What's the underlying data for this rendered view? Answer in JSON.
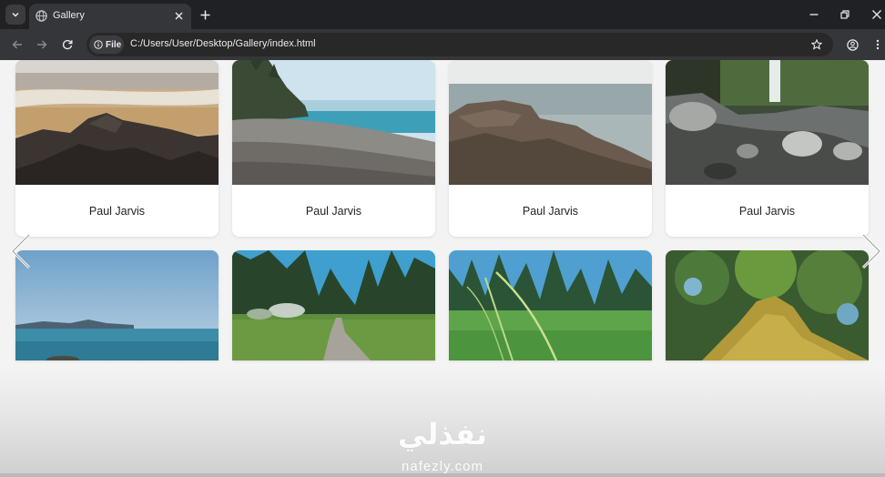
{
  "browser": {
    "tab_title": "Gallery",
    "address_chip_label": "File",
    "url": "C:/Users/User/Desktop/Gallery/index.html"
  },
  "gallery": {
    "cards": [
      {
        "caption": "Paul Jarvis",
        "scene": "beach-rocks"
      },
      {
        "caption": "Paul Jarvis",
        "scene": "pebble-shore"
      },
      {
        "caption": "Paul Jarvis",
        "scene": "rocky-coast"
      },
      {
        "caption": "Paul Jarvis",
        "scene": "waterfall-creek"
      },
      {
        "caption": "",
        "scene": "calm-sea"
      },
      {
        "caption": "",
        "scene": "forest-path"
      },
      {
        "caption": "",
        "scene": "grass-meadow"
      },
      {
        "caption": "",
        "scene": "mossy-log"
      }
    ]
  },
  "watermark": {
    "arabic": "نفذلي",
    "latin": "nafezly.com"
  },
  "icons": [
    "tab-search-icon",
    "globe-icon",
    "close-icon",
    "plus-icon",
    "minimize-icon",
    "restore-icon",
    "back-icon",
    "forward-icon",
    "reload-icon",
    "info-icon",
    "star-icon",
    "profile-icon",
    "menu-icon",
    "chevron-left-icon",
    "chevron-right-icon"
  ]
}
